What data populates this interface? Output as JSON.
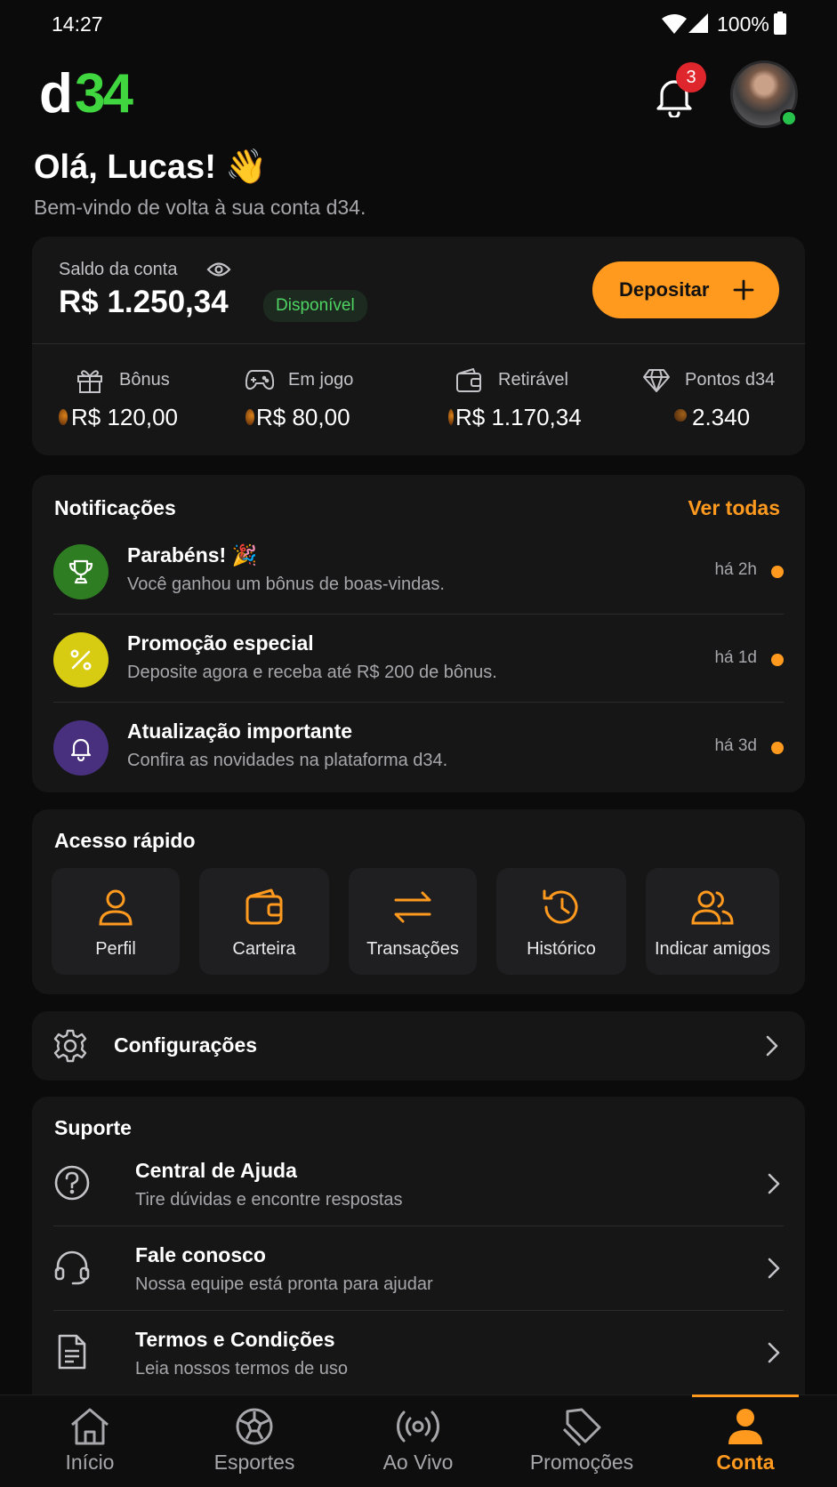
{
  "status_bar": {
    "time": "14:27",
    "battery": "100%"
  },
  "header": {
    "logo": "d34",
    "notification_count": "3"
  },
  "greeting": {
    "title": "Olá, Lucas! 👋",
    "subtitle": "Bem-vindo de volta à sua conta d34."
  },
  "balance": {
    "label": "Saldo da conta",
    "amount": "R$ 1.250,34",
    "badge": "Disponível",
    "deposit_label": "Depositar",
    "stats": [
      {
        "label": "Bônus",
        "value": "R$ 120,00",
        "icon": "gift-icon"
      },
      {
        "label": "Em jogo",
        "value": "R$ 80,00",
        "icon": "gamepad-icon"
      },
      {
        "label": "Retirável",
        "value": "R$ 1.170,34",
        "icon": "wallet-icon"
      },
      {
        "label": "Pontos d34",
        "value": "2.340",
        "icon": "diamond-icon"
      }
    ]
  },
  "notifications": {
    "title": "Notificações",
    "see_all": "Ver todas",
    "items": [
      {
        "title": "Parabéns! 🎉",
        "subtitle": "Você ganhou um bônus de boas-vindas.",
        "time": "há 2h",
        "icon": "trophy-icon",
        "color": "#2f7d23"
      },
      {
        "title": "Promoção especial",
        "subtitle": "Deposite agora e receba até R$ 200 de bônus.",
        "time": "há 1d",
        "icon": "percent-icon",
        "color": "#d8cc13"
      },
      {
        "title": "Atualização importante",
        "subtitle": "Confira as novidades na plataforma d34.",
        "time": "há 3d",
        "icon": "bell-icon",
        "color": "#48307e"
      }
    ]
  },
  "quick_access": {
    "title": "Acesso rápido",
    "items": [
      {
        "label": "Perfil",
        "icon": "user-icon"
      },
      {
        "label": "Carteira",
        "icon": "wallet-icon"
      },
      {
        "label": "Transações",
        "icon": "transfer-icon"
      },
      {
        "label": "Histórico",
        "icon": "history-icon"
      },
      {
        "label": "Indicar amigos",
        "icon": "users-icon"
      }
    ]
  },
  "settings": {
    "label": "Configurações"
  },
  "support": {
    "title": "Suporte",
    "items": [
      {
        "title": "Central de Ajuda",
        "subtitle": "Tire dúvidas e encontre respostas",
        "icon": "help-icon"
      },
      {
        "title": "Fale conosco",
        "subtitle": "Nossa equipe está pronta para ajudar",
        "icon": "headset-icon"
      },
      {
        "title": "Termos e Condições",
        "subtitle": "Leia nossos termos de uso",
        "icon": "document-icon"
      }
    ]
  },
  "bottom_nav": {
    "active": "Conta",
    "items": [
      {
        "label": "Início",
        "icon": "home-icon"
      },
      {
        "label": "Esportes",
        "icon": "soccer-ball-icon"
      },
      {
        "label": "Ao Vivo",
        "icon": "live-icon"
      },
      {
        "label": "Promoções",
        "icon": "tag-icon"
      },
      {
        "label": "Conta",
        "icon": "user-icon"
      }
    ]
  },
  "colors": {
    "accent": "#ff9a1f",
    "logo_green": "#3fd63f",
    "background": "#0b0b0c",
    "card": "#161617",
    "badge_red": "#e0262d"
  }
}
